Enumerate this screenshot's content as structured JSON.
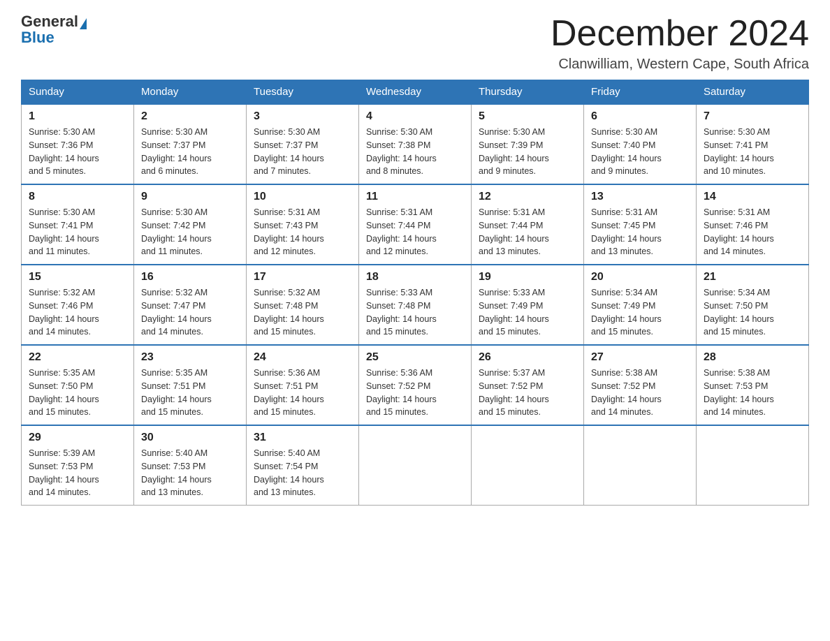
{
  "header": {
    "logo_general": "General",
    "logo_blue": "Blue",
    "title": "December 2024",
    "subtitle": "Clanwilliam, Western Cape, South Africa"
  },
  "weekdays": [
    "Sunday",
    "Monday",
    "Tuesday",
    "Wednesday",
    "Thursday",
    "Friday",
    "Saturday"
  ],
  "weeks": [
    [
      {
        "day": "1",
        "sunrise": "5:30 AM",
        "sunset": "7:36 PM",
        "daylight": "14 hours and 5 minutes."
      },
      {
        "day": "2",
        "sunrise": "5:30 AM",
        "sunset": "7:37 PM",
        "daylight": "14 hours and 6 minutes."
      },
      {
        "day": "3",
        "sunrise": "5:30 AM",
        "sunset": "7:37 PM",
        "daylight": "14 hours and 7 minutes."
      },
      {
        "day": "4",
        "sunrise": "5:30 AM",
        "sunset": "7:38 PM",
        "daylight": "14 hours and 8 minutes."
      },
      {
        "day": "5",
        "sunrise": "5:30 AM",
        "sunset": "7:39 PM",
        "daylight": "14 hours and 9 minutes."
      },
      {
        "day": "6",
        "sunrise": "5:30 AM",
        "sunset": "7:40 PM",
        "daylight": "14 hours and 9 minutes."
      },
      {
        "day": "7",
        "sunrise": "5:30 AM",
        "sunset": "7:41 PM",
        "daylight": "14 hours and 10 minutes."
      }
    ],
    [
      {
        "day": "8",
        "sunrise": "5:30 AM",
        "sunset": "7:41 PM",
        "daylight": "14 hours and 11 minutes."
      },
      {
        "day": "9",
        "sunrise": "5:30 AM",
        "sunset": "7:42 PM",
        "daylight": "14 hours and 11 minutes."
      },
      {
        "day": "10",
        "sunrise": "5:31 AM",
        "sunset": "7:43 PM",
        "daylight": "14 hours and 12 minutes."
      },
      {
        "day": "11",
        "sunrise": "5:31 AM",
        "sunset": "7:44 PM",
        "daylight": "14 hours and 12 minutes."
      },
      {
        "day": "12",
        "sunrise": "5:31 AM",
        "sunset": "7:44 PM",
        "daylight": "14 hours and 13 minutes."
      },
      {
        "day": "13",
        "sunrise": "5:31 AM",
        "sunset": "7:45 PM",
        "daylight": "14 hours and 13 minutes."
      },
      {
        "day": "14",
        "sunrise": "5:31 AM",
        "sunset": "7:46 PM",
        "daylight": "14 hours and 14 minutes."
      }
    ],
    [
      {
        "day": "15",
        "sunrise": "5:32 AM",
        "sunset": "7:46 PM",
        "daylight": "14 hours and 14 minutes."
      },
      {
        "day": "16",
        "sunrise": "5:32 AM",
        "sunset": "7:47 PM",
        "daylight": "14 hours and 14 minutes."
      },
      {
        "day": "17",
        "sunrise": "5:32 AM",
        "sunset": "7:48 PM",
        "daylight": "14 hours and 15 minutes."
      },
      {
        "day": "18",
        "sunrise": "5:33 AM",
        "sunset": "7:48 PM",
        "daylight": "14 hours and 15 minutes."
      },
      {
        "day": "19",
        "sunrise": "5:33 AM",
        "sunset": "7:49 PM",
        "daylight": "14 hours and 15 minutes."
      },
      {
        "day": "20",
        "sunrise": "5:34 AM",
        "sunset": "7:49 PM",
        "daylight": "14 hours and 15 minutes."
      },
      {
        "day": "21",
        "sunrise": "5:34 AM",
        "sunset": "7:50 PM",
        "daylight": "14 hours and 15 minutes."
      }
    ],
    [
      {
        "day": "22",
        "sunrise": "5:35 AM",
        "sunset": "7:50 PM",
        "daylight": "14 hours and 15 minutes."
      },
      {
        "day": "23",
        "sunrise": "5:35 AM",
        "sunset": "7:51 PM",
        "daylight": "14 hours and 15 minutes."
      },
      {
        "day": "24",
        "sunrise": "5:36 AM",
        "sunset": "7:51 PM",
        "daylight": "14 hours and 15 minutes."
      },
      {
        "day": "25",
        "sunrise": "5:36 AM",
        "sunset": "7:52 PM",
        "daylight": "14 hours and 15 minutes."
      },
      {
        "day": "26",
        "sunrise": "5:37 AM",
        "sunset": "7:52 PM",
        "daylight": "14 hours and 15 minutes."
      },
      {
        "day": "27",
        "sunrise": "5:38 AM",
        "sunset": "7:52 PM",
        "daylight": "14 hours and 14 minutes."
      },
      {
        "day": "28",
        "sunrise": "5:38 AM",
        "sunset": "7:53 PM",
        "daylight": "14 hours and 14 minutes."
      }
    ],
    [
      {
        "day": "29",
        "sunrise": "5:39 AM",
        "sunset": "7:53 PM",
        "daylight": "14 hours and 14 minutes."
      },
      {
        "day": "30",
        "sunrise": "5:40 AM",
        "sunset": "7:53 PM",
        "daylight": "14 hours and 13 minutes."
      },
      {
        "day": "31",
        "sunrise": "5:40 AM",
        "sunset": "7:54 PM",
        "daylight": "14 hours and 13 minutes."
      },
      null,
      null,
      null,
      null
    ]
  ],
  "labels": {
    "sunrise": "Sunrise:",
    "sunset": "Sunset:",
    "daylight": "Daylight:"
  }
}
